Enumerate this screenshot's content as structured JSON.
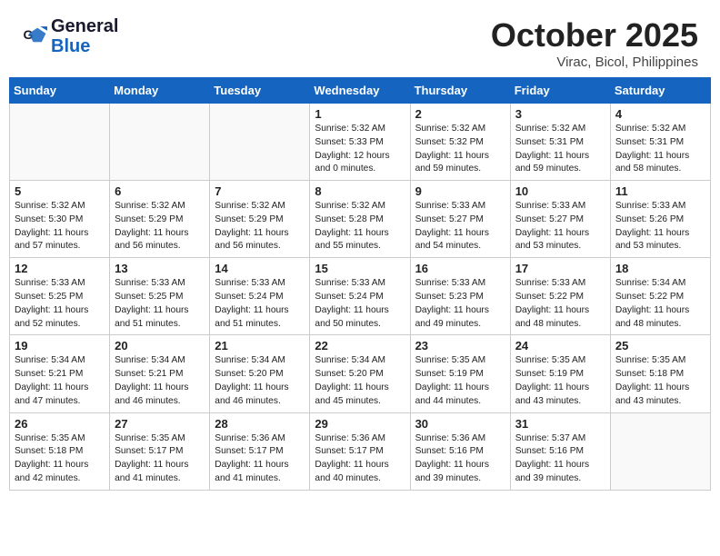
{
  "header": {
    "logo_general": "General",
    "logo_blue": "Blue",
    "month_title": "October 2025",
    "location": "Virac, Bicol, Philippines"
  },
  "weekdays": [
    "Sunday",
    "Monday",
    "Tuesday",
    "Wednesday",
    "Thursday",
    "Friday",
    "Saturday"
  ],
  "weeks": [
    [
      {
        "day": "",
        "sunrise": "",
        "sunset": "",
        "daylight": ""
      },
      {
        "day": "",
        "sunrise": "",
        "sunset": "",
        "daylight": ""
      },
      {
        "day": "",
        "sunrise": "",
        "sunset": "",
        "daylight": ""
      },
      {
        "day": "1",
        "sunrise": "Sunrise: 5:32 AM",
        "sunset": "Sunset: 5:33 PM",
        "daylight": "Daylight: 12 hours and 0 minutes."
      },
      {
        "day": "2",
        "sunrise": "Sunrise: 5:32 AM",
        "sunset": "Sunset: 5:32 PM",
        "daylight": "Daylight: 11 hours and 59 minutes."
      },
      {
        "day": "3",
        "sunrise": "Sunrise: 5:32 AM",
        "sunset": "Sunset: 5:31 PM",
        "daylight": "Daylight: 11 hours and 59 minutes."
      },
      {
        "day": "4",
        "sunrise": "Sunrise: 5:32 AM",
        "sunset": "Sunset: 5:31 PM",
        "daylight": "Daylight: 11 hours and 58 minutes."
      }
    ],
    [
      {
        "day": "5",
        "sunrise": "Sunrise: 5:32 AM",
        "sunset": "Sunset: 5:30 PM",
        "daylight": "Daylight: 11 hours and 57 minutes."
      },
      {
        "day": "6",
        "sunrise": "Sunrise: 5:32 AM",
        "sunset": "Sunset: 5:29 PM",
        "daylight": "Daylight: 11 hours and 56 minutes."
      },
      {
        "day": "7",
        "sunrise": "Sunrise: 5:32 AM",
        "sunset": "Sunset: 5:29 PM",
        "daylight": "Daylight: 11 hours and 56 minutes."
      },
      {
        "day": "8",
        "sunrise": "Sunrise: 5:32 AM",
        "sunset": "Sunset: 5:28 PM",
        "daylight": "Daylight: 11 hours and 55 minutes."
      },
      {
        "day": "9",
        "sunrise": "Sunrise: 5:33 AM",
        "sunset": "Sunset: 5:27 PM",
        "daylight": "Daylight: 11 hours and 54 minutes."
      },
      {
        "day": "10",
        "sunrise": "Sunrise: 5:33 AM",
        "sunset": "Sunset: 5:27 PM",
        "daylight": "Daylight: 11 hours and 53 minutes."
      },
      {
        "day": "11",
        "sunrise": "Sunrise: 5:33 AM",
        "sunset": "Sunset: 5:26 PM",
        "daylight": "Daylight: 11 hours and 53 minutes."
      }
    ],
    [
      {
        "day": "12",
        "sunrise": "Sunrise: 5:33 AM",
        "sunset": "Sunset: 5:25 PM",
        "daylight": "Daylight: 11 hours and 52 minutes."
      },
      {
        "day": "13",
        "sunrise": "Sunrise: 5:33 AM",
        "sunset": "Sunset: 5:25 PM",
        "daylight": "Daylight: 11 hours and 51 minutes."
      },
      {
        "day": "14",
        "sunrise": "Sunrise: 5:33 AM",
        "sunset": "Sunset: 5:24 PM",
        "daylight": "Daylight: 11 hours and 51 minutes."
      },
      {
        "day": "15",
        "sunrise": "Sunrise: 5:33 AM",
        "sunset": "Sunset: 5:24 PM",
        "daylight": "Daylight: 11 hours and 50 minutes."
      },
      {
        "day": "16",
        "sunrise": "Sunrise: 5:33 AM",
        "sunset": "Sunset: 5:23 PM",
        "daylight": "Daylight: 11 hours and 49 minutes."
      },
      {
        "day": "17",
        "sunrise": "Sunrise: 5:33 AM",
        "sunset": "Sunset: 5:22 PM",
        "daylight": "Daylight: 11 hours and 48 minutes."
      },
      {
        "day": "18",
        "sunrise": "Sunrise: 5:34 AM",
        "sunset": "Sunset: 5:22 PM",
        "daylight": "Daylight: 11 hours and 48 minutes."
      }
    ],
    [
      {
        "day": "19",
        "sunrise": "Sunrise: 5:34 AM",
        "sunset": "Sunset: 5:21 PM",
        "daylight": "Daylight: 11 hours and 47 minutes."
      },
      {
        "day": "20",
        "sunrise": "Sunrise: 5:34 AM",
        "sunset": "Sunset: 5:21 PM",
        "daylight": "Daylight: 11 hours and 46 minutes."
      },
      {
        "day": "21",
        "sunrise": "Sunrise: 5:34 AM",
        "sunset": "Sunset: 5:20 PM",
        "daylight": "Daylight: 11 hours and 46 minutes."
      },
      {
        "day": "22",
        "sunrise": "Sunrise: 5:34 AM",
        "sunset": "Sunset: 5:20 PM",
        "daylight": "Daylight: 11 hours and 45 minutes."
      },
      {
        "day": "23",
        "sunrise": "Sunrise: 5:35 AM",
        "sunset": "Sunset: 5:19 PM",
        "daylight": "Daylight: 11 hours and 44 minutes."
      },
      {
        "day": "24",
        "sunrise": "Sunrise: 5:35 AM",
        "sunset": "Sunset: 5:19 PM",
        "daylight": "Daylight: 11 hours and 43 minutes."
      },
      {
        "day": "25",
        "sunrise": "Sunrise: 5:35 AM",
        "sunset": "Sunset: 5:18 PM",
        "daylight": "Daylight: 11 hours and 43 minutes."
      }
    ],
    [
      {
        "day": "26",
        "sunrise": "Sunrise: 5:35 AM",
        "sunset": "Sunset: 5:18 PM",
        "daylight": "Daylight: 11 hours and 42 minutes."
      },
      {
        "day": "27",
        "sunrise": "Sunrise: 5:35 AM",
        "sunset": "Sunset: 5:17 PM",
        "daylight": "Daylight: 11 hours and 41 minutes."
      },
      {
        "day": "28",
        "sunrise": "Sunrise: 5:36 AM",
        "sunset": "Sunset: 5:17 PM",
        "daylight": "Daylight: 11 hours and 41 minutes."
      },
      {
        "day": "29",
        "sunrise": "Sunrise: 5:36 AM",
        "sunset": "Sunset: 5:17 PM",
        "daylight": "Daylight: 11 hours and 40 minutes."
      },
      {
        "day": "30",
        "sunrise": "Sunrise: 5:36 AM",
        "sunset": "Sunset: 5:16 PM",
        "daylight": "Daylight: 11 hours and 39 minutes."
      },
      {
        "day": "31",
        "sunrise": "Sunrise: 5:37 AM",
        "sunset": "Sunset: 5:16 PM",
        "daylight": "Daylight: 11 hours and 39 minutes."
      },
      {
        "day": "",
        "sunrise": "",
        "sunset": "",
        "daylight": ""
      }
    ]
  ]
}
